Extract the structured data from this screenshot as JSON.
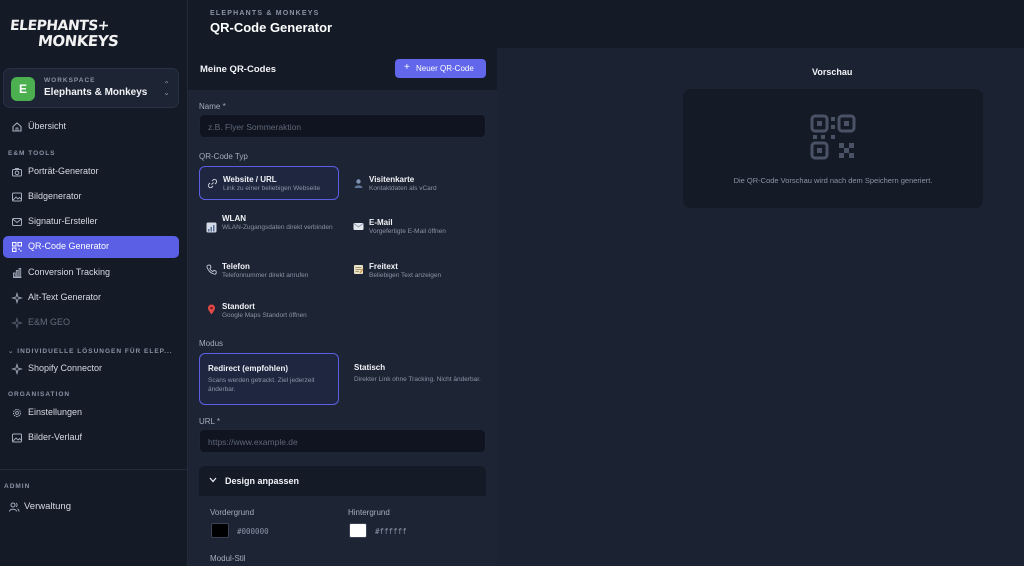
{
  "brand": {
    "logo_line1": "ELEPHANTS+",
    "logo_line2": "MONKEYS"
  },
  "workspace": {
    "label": "WORKSPACE",
    "name": "Elephants & Monkeys",
    "avatar": "E",
    "avatar_color": "#4caf50"
  },
  "sidebar": {
    "overview": {
      "label": "Übersicht",
      "icon": "home-icon"
    },
    "tools_section": "E&M TOOLS",
    "tools": [
      {
        "label": "Porträt-Generator",
        "icon": "camera-icon"
      },
      {
        "label": "Bildgenerator",
        "icon": "image-icon"
      },
      {
        "label": "Signatur-Ersteller",
        "icon": "mail-icon"
      },
      {
        "label": "QR-Code Generator",
        "icon": "qr-icon",
        "active": true
      },
      {
        "label": "Conversion Tracking",
        "icon": "bar-chart-icon"
      },
      {
        "label": "Alt-Text Generator",
        "icon": "sparkle-icon"
      },
      {
        "label": "E&M GEO",
        "icon": "sparkle-icon",
        "disabled": true
      }
    ],
    "custom_section": "INDIVIDUELLE LÖSUNGEN FÜR ELEP...",
    "custom": [
      {
        "label": "Shopify Connector",
        "icon": "sparkle-icon"
      }
    ],
    "org_section": "ORGANISATION",
    "org": [
      {
        "label": "Einstellungen",
        "icon": "gear-icon"
      },
      {
        "label": "Bilder-Verlauf",
        "icon": "image-icon"
      }
    ],
    "admin_section": "ADMIN",
    "admin": [
      {
        "label": "Verwaltung",
        "icon": "users-icon"
      }
    ]
  },
  "header": {
    "eyebrow": "ELEPHANTS & MONKEYS",
    "title": "QR-Code Generator"
  },
  "panel": {
    "title": "Meine QR-Codes",
    "new_button": "Neuer QR-Code"
  },
  "form": {
    "name_label": "Name *",
    "name_placeholder": "z.B. Flyer Sommeraktion",
    "type_label": "QR-Code Typ",
    "types": [
      {
        "title": "Website / URL",
        "desc": "Link zu einer beliebigen Webseite",
        "icon": "link-icon",
        "selected": true
      },
      {
        "title": "Visitenkarte",
        "desc": "Kontaktdaten als vCard",
        "icon": "person-icon"
      },
      {
        "title": "WLAN",
        "desc": "WLAN-Zugangsdaten direkt verbinden",
        "icon": "wifi-icon"
      },
      {
        "title": "E-Mail",
        "desc": "Vorgefertigte E-Mail öffnen",
        "icon": "envelope-icon"
      },
      {
        "title": "Telefon",
        "desc": "Telefonnummer direkt anrufen",
        "icon": "phone-icon"
      },
      {
        "title": "Freitext",
        "desc": "Beliebigen Text anzeigen",
        "icon": "note-icon"
      },
      {
        "title": "Standort",
        "desc": "Google Maps Standort öffnen",
        "icon": "pin-icon"
      }
    ],
    "mode_label": "Modus",
    "modes": [
      {
        "title": "Redirect (empfohlen)",
        "desc": "Scans werden getrackt. Ziel jederzeit änderbar.",
        "selected": true
      },
      {
        "title": "Statisch",
        "desc": "Direkter Link ohne Tracking. Nicht änderbar."
      }
    ],
    "url_label": "URL *",
    "url_placeholder": "https://www.example.de",
    "design_title": "Design anpassen",
    "foreground_label": "Vordergrund",
    "foreground_value": "#000000",
    "background_label": "Hintergrund",
    "background_value": "#ffffff",
    "module_style_label": "Modul-Stil"
  },
  "preview": {
    "title": "Vorschau",
    "text": "Die QR-Code Vorschau wird nach dem Speichern generiert."
  },
  "colors": {
    "accent": "#5b5fe6",
    "sidebar_bg": "#141a26",
    "panel_bg": "#1d2433",
    "body_bg": "#1b2231"
  }
}
